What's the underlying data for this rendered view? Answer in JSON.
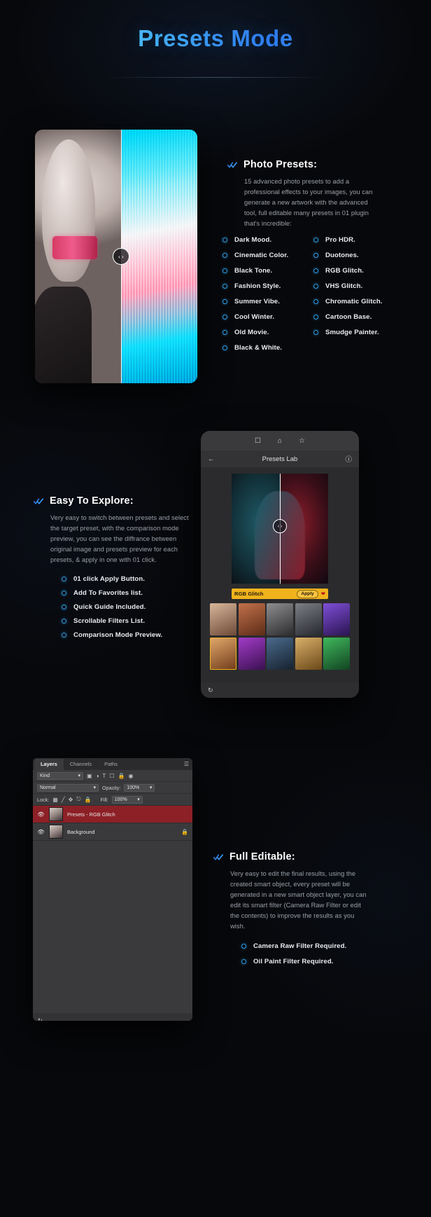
{
  "header": {
    "title": "Presets Mode"
  },
  "icons": {
    "double_check": "double-check-icon",
    "compare_handle": "‹ ›"
  },
  "section1": {
    "title": "Photo Presets:",
    "body": "15 advanced photo presets to add a professional effects to your images, you can generate a new artwork with the advanced tool, full editable many presets in 01 plugin that's incredible:",
    "presets_left": [
      "Dark Mood.",
      "Cinematic Color.",
      "Black Tone.",
      "Fashion Style.",
      "Summer Vibe.",
      "Cool Winter.",
      "Old Movie.",
      "Black & White."
    ],
    "presets_right": [
      "Pro HDR.",
      "Duotones.",
      "RGB Glitch.",
      "VHS Glitch.",
      "Chromatic Glitch.",
      "Cartoon Base.",
      "Smudge Painter."
    ]
  },
  "section2": {
    "title": "Easy To Explore:",
    "body": "Very easy to switch between presets and select the target preset, with the comparison mode preview, you can see the diffrance between original image and presets preview for each presets, & apply in one with 01 click.",
    "features": [
      "01 click Apply Button.",
      "Add To Favorites list.",
      "Quick Guide Included.",
      "Scrollable Filters List.",
      "Comparison Mode Preview."
    ],
    "phone": {
      "topbar_icons": [
        "save-icon",
        "home-icon",
        "star-icon"
      ],
      "back_icon": "arrow-left-icon",
      "screen_title": "Presets Lab",
      "info_icon": "info-icon",
      "apply_bar": {
        "preset_name": "RGB Glitch",
        "apply_label": "Apply",
        "favorite_icon": "heart-icon"
      },
      "footer_icon": "refresh-icon",
      "thumbnails": [
        {
          "id": "t1",
          "c1": "#d8b69a",
          "c2": "#6e4a38",
          "selected": false
        },
        {
          "id": "t2",
          "c1": "#c2714a",
          "c2": "#5d2c18",
          "selected": false
        },
        {
          "id": "t3",
          "c1": "#8e8e90",
          "c2": "#2c2c2e",
          "selected": false
        },
        {
          "id": "t4",
          "c1": "#7d7f86",
          "c2": "#26282e",
          "selected": false
        },
        {
          "id": "t5",
          "c1": "#7f4fd8",
          "c2": "#2a1450",
          "selected": false
        },
        {
          "id": "t6",
          "c1": "#e2a86c",
          "c2": "#703c1a",
          "selected": true
        },
        {
          "id": "t7",
          "c1": "#a23cc8",
          "c2": "#3a1050",
          "selected": false
        },
        {
          "id": "t8",
          "c1": "#4a6a8c",
          "c2": "#16222e",
          "selected": false
        },
        {
          "id": "t9",
          "c1": "#d9b06a",
          "c2": "#6a4818",
          "selected": false
        },
        {
          "id": "t10",
          "c1": "#3fb85c",
          "c2": "#124422",
          "selected": false
        }
      ]
    }
  },
  "section3": {
    "title": "Full Editable:",
    "body": "Very easy to edit the final results, using the created smart object, every preset will be generated in a new smart object layer, you can edit its smart filter (Camera Raw Filter or edit the contents) to improve the results as you wish.",
    "requirements": [
      "Camera Raw Filter Required.",
      "Oil Paint Filter Required."
    ],
    "panel": {
      "tabs": [
        "Layers",
        "Channels",
        "Paths"
      ],
      "menu_icon": "panel-menu-icon",
      "filter_value": "Kind",
      "filter_icons": [
        "pixel-layer-icon",
        "adjustment-layer-icon",
        "type-layer-icon",
        "shape-layer-icon",
        "smart-object-icon",
        "toggle-icon"
      ],
      "blend_mode": "Normal",
      "opacity_label": "Opacity:",
      "opacity_value": "100%",
      "lock_label": "Lock:",
      "lock_icons": [
        "lock-transparency-icon",
        "lock-image-icon",
        "lock-position-icon",
        "lock-nesting-icon",
        "lock-all-icon"
      ],
      "fill_label": "Fill:",
      "fill_value": "100%",
      "layers": [
        {
          "name": "Presets - RGB Glitch",
          "selected": true,
          "locked": false
        },
        {
          "name": "Background",
          "selected": false,
          "locked": true
        }
      ]
    }
  },
  "colors": {
    "accent_blue": "#2f9fe8",
    "title_gradient_start": "#3aa8f5",
    "title_gradient_end": "#2f7cf0",
    "apply_yellow": "#f0b31d",
    "layer_selected": "#8d2026",
    "page_bg": "#07080b"
  }
}
